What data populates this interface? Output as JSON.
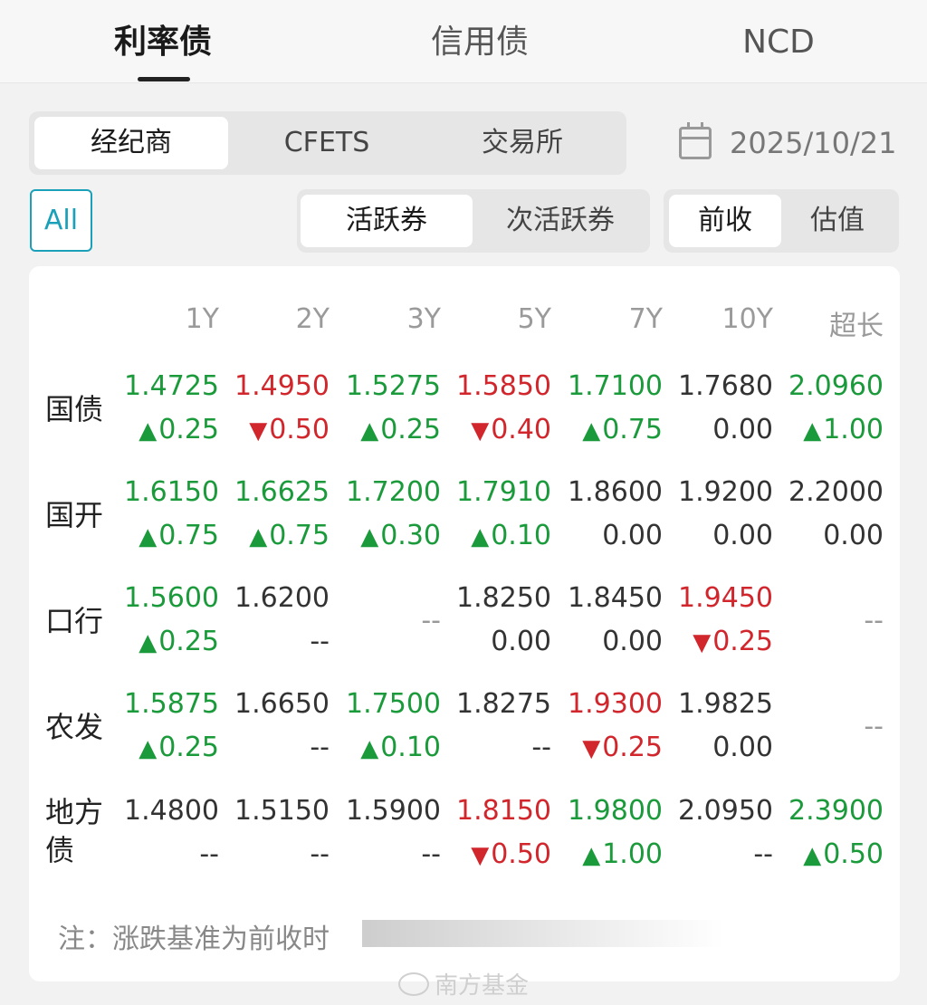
{
  "top_tabs": [
    "利率债",
    "信用债",
    "NCD"
  ],
  "source_tabs": [
    "经纪商",
    "CFETS",
    "交易所"
  ],
  "date": "2025/10/21",
  "filter_all": "All",
  "activity_tabs": [
    "活跃券",
    "次活跃券"
  ],
  "price_tabs": [
    "前收",
    "估值"
  ],
  "columns": [
    "1Y",
    "2Y",
    "3Y",
    "5Y",
    "7Y",
    "10Y",
    "超长"
  ],
  "rows": [
    {
      "label": "国债",
      "cells": [
        {
          "value": "1.4725",
          "change": "0.25",
          "dir": "up"
        },
        {
          "value": "1.4950",
          "change": "0.50",
          "dir": "down"
        },
        {
          "value": "1.5275",
          "change": "0.25",
          "dir": "up"
        },
        {
          "value": "1.5850",
          "change": "0.40",
          "dir": "down"
        },
        {
          "value": "1.7100",
          "change": "0.75",
          "dir": "up"
        },
        {
          "value": "1.7680",
          "change": "0.00",
          "dir": "flat"
        },
        {
          "value": "2.0960",
          "change": "1.00",
          "dir": "up"
        }
      ]
    },
    {
      "label": "国开",
      "cells": [
        {
          "value": "1.6150",
          "change": "0.75",
          "dir": "up"
        },
        {
          "value": "1.6625",
          "change": "0.75",
          "dir": "up"
        },
        {
          "value": "1.7200",
          "change": "0.30",
          "dir": "up"
        },
        {
          "value": "1.7910",
          "change": "0.10",
          "dir": "up"
        },
        {
          "value": "1.8600",
          "change": "0.00",
          "dir": "flat"
        },
        {
          "value": "1.9200",
          "change": "0.00",
          "dir": "flat"
        },
        {
          "value": "2.2000",
          "change": "0.00",
          "dir": "flat"
        }
      ]
    },
    {
      "label": "口行",
      "cells": [
        {
          "value": "1.5600",
          "change": "0.25",
          "dir": "up"
        },
        {
          "value": "1.6200",
          "change": "--",
          "dir": "none"
        },
        {
          "value": "--",
          "change": "",
          "dir": "empty"
        },
        {
          "value": "1.8250",
          "change": "0.00",
          "dir": "flat"
        },
        {
          "value": "1.8450",
          "change": "0.00",
          "dir": "flat"
        },
        {
          "value": "1.9450",
          "change": "0.25",
          "dir": "down"
        },
        {
          "value": "--",
          "change": "",
          "dir": "empty"
        }
      ]
    },
    {
      "label": "农发",
      "cells": [
        {
          "value": "1.5875",
          "change": "0.25",
          "dir": "up"
        },
        {
          "value": "1.6650",
          "change": "--",
          "dir": "none"
        },
        {
          "value": "1.7500",
          "change": "0.10",
          "dir": "up"
        },
        {
          "value": "1.8275",
          "change": "--",
          "dir": "none"
        },
        {
          "value": "1.9300",
          "change": "0.25",
          "dir": "down"
        },
        {
          "value": "1.9825",
          "change": "0.00",
          "dir": "flat"
        },
        {
          "value": "--",
          "change": "",
          "dir": "empty"
        }
      ]
    },
    {
      "label": "地方债",
      "cells": [
        {
          "value": "1.4800",
          "change": "--",
          "dir": "none"
        },
        {
          "value": "1.5150",
          "change": "--",
          "dir": "none"
        },
        {
          "value": "1.5900",
          "change": "--",
          "dir": "none"
        },
        {
          "value": "1.8150",
          "change": "0.50",
          "dir": "down"
        },
        {
          "value": "1.9800",
          "change": "1.00",
          "dir": "up"
        },
        {
          "value": "2.0950",
          "change": "--",
          "dir": "none"
        },
        {
          "value": "2.3900",
          "change": "0.50",
          "dir": "up"
        }
      ]
    }
  ],
  "note": "注：涨跌基准为前收时",
  "watermark": "南方基金",
  "colors": {
    "up": "#1a9a3a",
    "down": "#d0262c",
    "accent": "#1aa0b8"
  }
}
